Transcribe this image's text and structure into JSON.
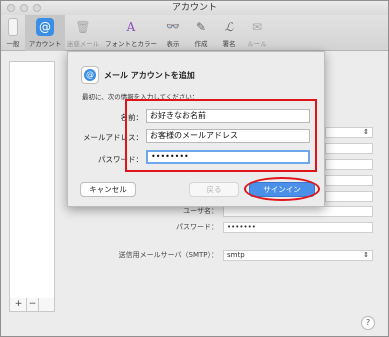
{
  "window": {
    "title": "アカウント"
  },
  "toolbar": {
    "items": [
      {
        "label": "一般",
        "icon": "switch-icon"
      },
      {
        "label": "アカウント",
        "icon": "at-icon"
      },
      {
        "label": "迷惑メール",
        "icon": "trash-icon"
      },
      {
        "label": "フォントとカラー",
        "icon": "font-icon"
      },
      {
        "label": "表示",
        "icon": "glasses-icon"
      },
      {
        "label": "作成",
        "icon": "pencil-icon"
      },
      {
        "label": "署名",
        "icon": "signature-icon"
      },
      {
        "label": "ルール",
        "icon": "envelope-icon"
      }
    ]
  },
  "background": {
    "list_add": "+",
    "list_remove": "−",
    "username_label": "ユーザ名：",
    "password_label": "パスワード：",
    "password_value": "•••••••",
    "smtp_label": "送信用メールサーバ（SMTP）：",
    "smtp_value": "smtp",
    "help": "?"
  },
  "dialog": {
    "title": "メール アカウントを追加",
    "subtitle": "最初に、次の情報を入力してください：",
    "name_label": "名前：",
    "name_value": "お好きなお名前",
    "email_label": "メールアドレス：",
    "email_value": "お客様のメールアドレス",
    "password_label": "パスワード：",
    "password_value": "••••••••",
    "cancel_label": "キャンセル",
    "back_label": "戻る",
    "signin_label": "サインイン"
  },
  "colors": {
    "accent_blue": "#4a8fe8",
    "highlight_red": "#e0151a"
  }
}
